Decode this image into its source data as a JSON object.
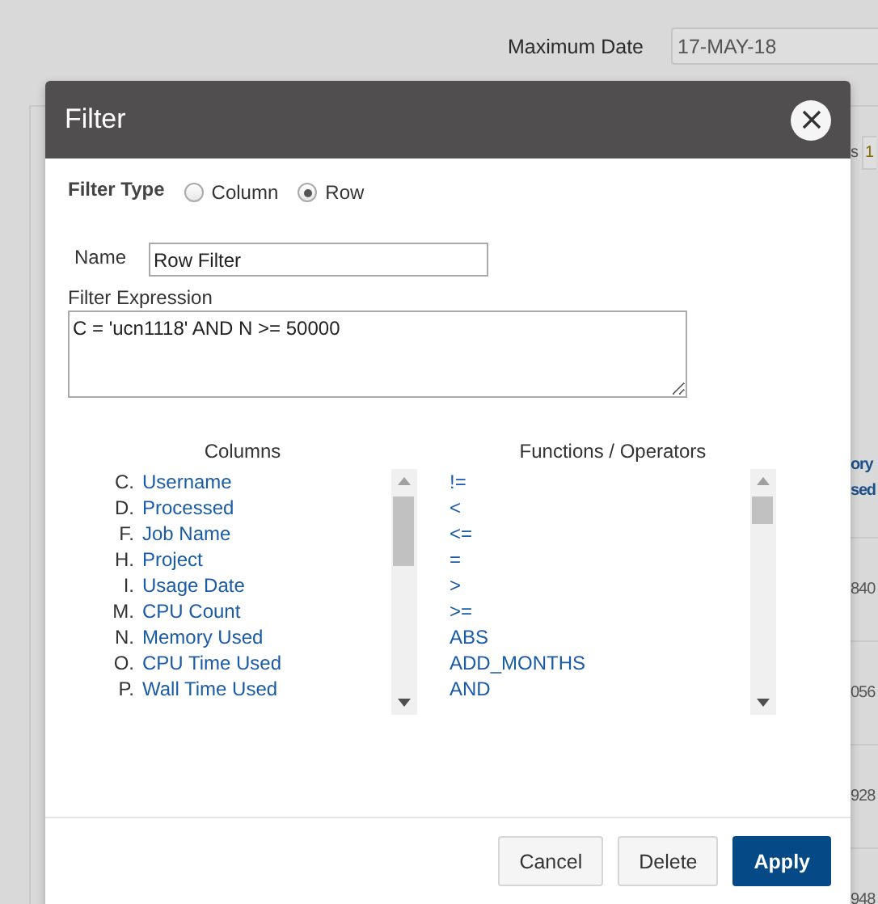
{
  "background": {
    "max_date_label": "Maximum Date",
    "max_date_value": "17-MAY-18",
    "edge_label": "s",
    "edge_field": "1",
    "edge_header": [
      "ory",
      "sed"
    ],
    "edge_cells": [
      "840",
      "056",
      "928",
      "948"
    ]
  },
  "dialog": {
    "title": "Filter",
    "filter_type": {
      "label": "Filter Type",
      "options": [
        {
          "label": "Column",
          "selected": false
        },
        {
          "label": "Row",
          "selected": true
        }
      ]
    },
    "name": {
      "label": "Name",
      "value": "Row Filter"
    },
    "expression": {
      "label": "Filter Expression",
      "value": "C = 'ucn1118' AND N >= 50000"
    },
    "columns": {
      "header": "Columns",
      "items": [
        {
          "letter": "C.",
          "name": "Username"
        },
        {
          "letter": "D.",
          "name": "Processed"
        },
        {
          "letter": "F.",
          "name": "Job Name"
        },
        {
          "letter": "H.",
          "name": "Project"
        },
        {
          "letter": "I.",
          "name": "Usage Date"
        },
        {
          "letter": "M.",
          "name": "CPU Count"
        },
        {
          "letter": "N.",
          "name": "Memory Used"
        },
        {
          "letter": "O.",
          "name": "CPU Time Used"
        },
        {
          "letter": "P.",
          "name": "Wall Time Used"
        }
      ]
    },
    "functions": {
      "header": "Functions / Operators",
      "items": [
        "!=",
        "<",
        "<=",
        "=",
        ">",
        ">=",
        "ABS",
        "ADD_MONTHS",
        "AND"
      ]
    },
    "buttons": [
      {
        "label": "Cancel",
        "kind": "secondary"
      },
      {
        "label": "Delete",
        "kind": "secondary"
      },
      {
        "label": "Apply",
        "kind": "primary"
      }
    ]
  }
}
